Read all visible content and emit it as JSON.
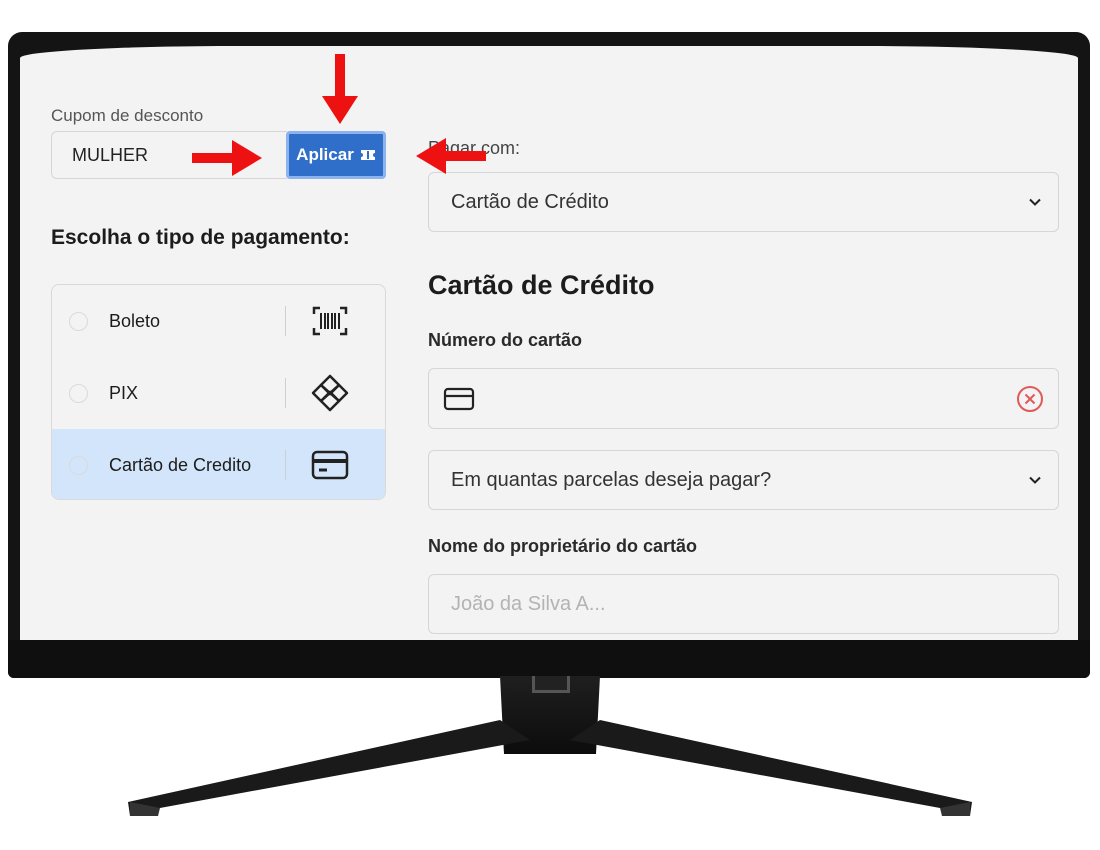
{
  "coupon": {
    "label": "Cupom de desconto",
    "value": "MULHER",
    "apply_label": "Aplicar"
  },
  "payment_type": {
    "title": "Escolha o tipo de pagamento:",
    "options": [
      {
        "label": "Boleto",
        "icon": "barcode-icon",
        "selected": false
      },
      {
        "label": "PIX",
        "icon": "pix-icon",
        "selected": false
      },
      {
        "label": "Cartão de Credito",
        "icon": "credit-card-icon",
        "selected": true
      }
    ]
  },
  "pay_with": {
    "label": "Pagar com:",
    "selected": "Cartão de Crédito"
  },
  "credit_card": {
    "section_title": "Cartão de Crédito",
    "number_label": "Número do cartão",
    "number_value": "",
    "installments_placeholder": "Em quantas parcelas deseja pagar?",
    "owner_label": "Nome do proprietário do cartão",
    "owner_placeholder": "João da Silva A..."
  },
  "colors": {
    "accent": "#2f6fc9",
    "selected_row": "#d3e5fa",
    "error": "#e05a5a",
    "annotation_arrow": "#ee1111"
  }
}
